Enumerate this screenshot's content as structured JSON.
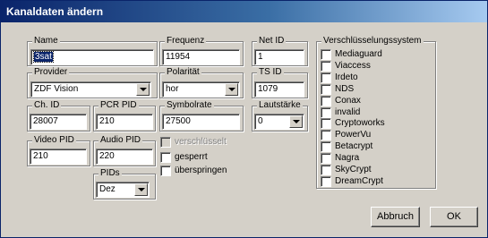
{
  "window": {
    "title": "Kanaldaten ändern"
  },
  "fields": {
    "name": {
      "label": "Name",
      "value": "3sat"
    },
    "frequenz": {
      "label": "Frequenz",
      "value": "11954"
    },
    "net_id": {
      "label": "Net ID",
      "value": "1"
    },
    "provider": {
      "label": "Provider",
      "value": "ZDF Vision"
    },
    "polaritaet": {
      "label": "Polarität",
      "value": "hor"
    },
    "ts_id": {
      "label": "TS ID",
      "value": "1079"
    },
    "ch_id": {
      "label": "Ch. ID",
      "value": "28007"
    },
    "pcr_pid": {
      "label": "PCR PID",
      "value": "210"
    },
    "symbolrate": {
      "label": "Symbolrate",
      "value": "27500"
    },
    "lautstaerke": {
      "label": "Lautstärke",
      "value": "0"
    },
    "video_pid": {
      "label": "Video PID",
      "value": "210"
    },
    "audio_pid": {
      "label": "Audio PID",
      "value": "220"
    },
    "pids": {
      "label": "PIDs",
      "value": "Dez"
    }
  },
  "flags": {
    "verschluesselt": {
      "label": "verschlüsselt",
      "checked": false,
      "disabled": true
    },
    "gesperrt": {
      "label": "gesperrt",
      "checked": false
    },
    "ueberspringen": {
      "label": "überspringen",
      "checked": false
    }
  },
  "encryption": {
    "label": "Verschlüsselungssystem",
    "items": [
      {
        "label": "Mediaguard",
        "checked": false
      },
      {
        "label": "Viaccess",
        "checked": false
      },
      {
        "label": "Irdeto",
        "checked": false
      },
      {
        "label": "NDS",
        "checked": false
      },
      {
        "label": "Conax",
        "checked": false
      },
      {
        "label": "invalid",
        "checked": false
      },
      {
        "label": "Cryptoworks",
        "checked": false
      },
      {
        "label": "PowerVu",
        "checked": false
      },
      {
        "label": "Betacrypt",
        "checked": false
      },
      {
        "label": "Nagra",
        "checked": false
      },
      {
        "label": "SkyCrypt",
        "checked": false
      },
      {
        "label": "DreamCrypt",
        "checked": false
      }
    ]
  },
  "buttons": {
    "cancel": "Abbruch",
    "ok": "OK"
  },
  "colors": {
    "titlebar": "#0a246a",
    "face": "#d4d0c8",
    "selection": "#0a246a"
  }
}
